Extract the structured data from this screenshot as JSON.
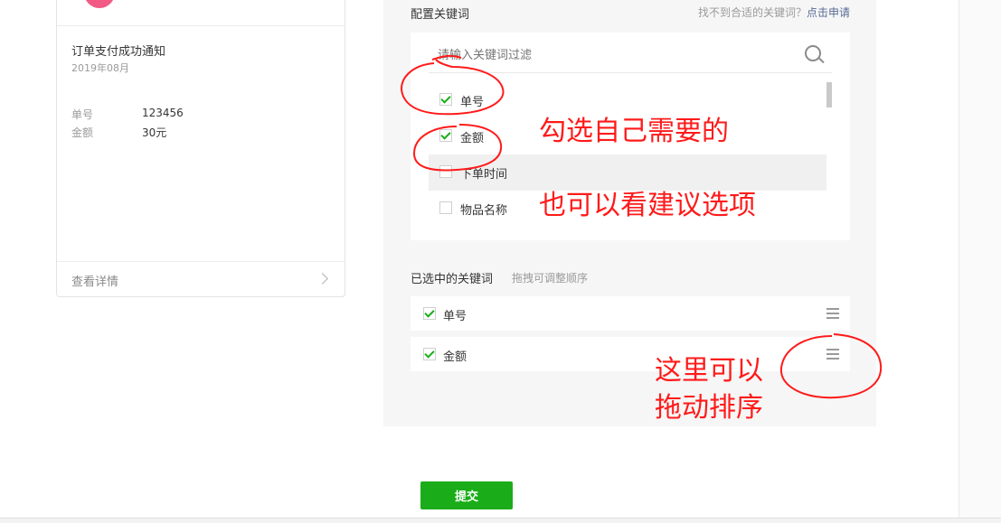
{
  "preview_card": {
    "title": "订单支付成功通知",
    "date": "2019年08月",
    "fields": [
      {
        "label": "单号",
        "value": "123456"
      },
      {
        "label": "金额",
        "value": "30元"
      }
    ],
    "details_link": "查看详情",
    "logo_color": "#f25a85"
  },
  "config": {
    "label": "配置关键词",
    "hint_text": "找不到合适的关键词？",
    "hint_link": "点击申请",
    "search_placeholder": "请输入关键词过滤",
    "keywords": [
      {
        "label": "单号",
        "checked": true
      },
      {
        "label": "金额",
        "checked": true
      },
      {
        "label": "下单时间",
        "checked": false
      },
      {
        "label": "物品名称",
        "checked": false
      }
    ]
  },
  "selected": {
    "label": "已选中的关键词",
    "hint": "拖拽可调整顺序",
    "items": [
      {
        "label": "单号"
      },
      {
        "label": "金额"
      }
    ]
  },
  "submit_label": "提交",
  "annotations": {
    "text1": "勾选自己需要的",
    "text2": "也可以看建议选项",
    "text3_line1": "这里可以",
    "text3_line2": "拖动排序",
    "color": "#ff1a1a"
  },
  "colors": {
    "accent_green": "#1aad19",
    "link_blue": "#576b95",
    "panel_bg": "#f6f6f6"
  }
}
